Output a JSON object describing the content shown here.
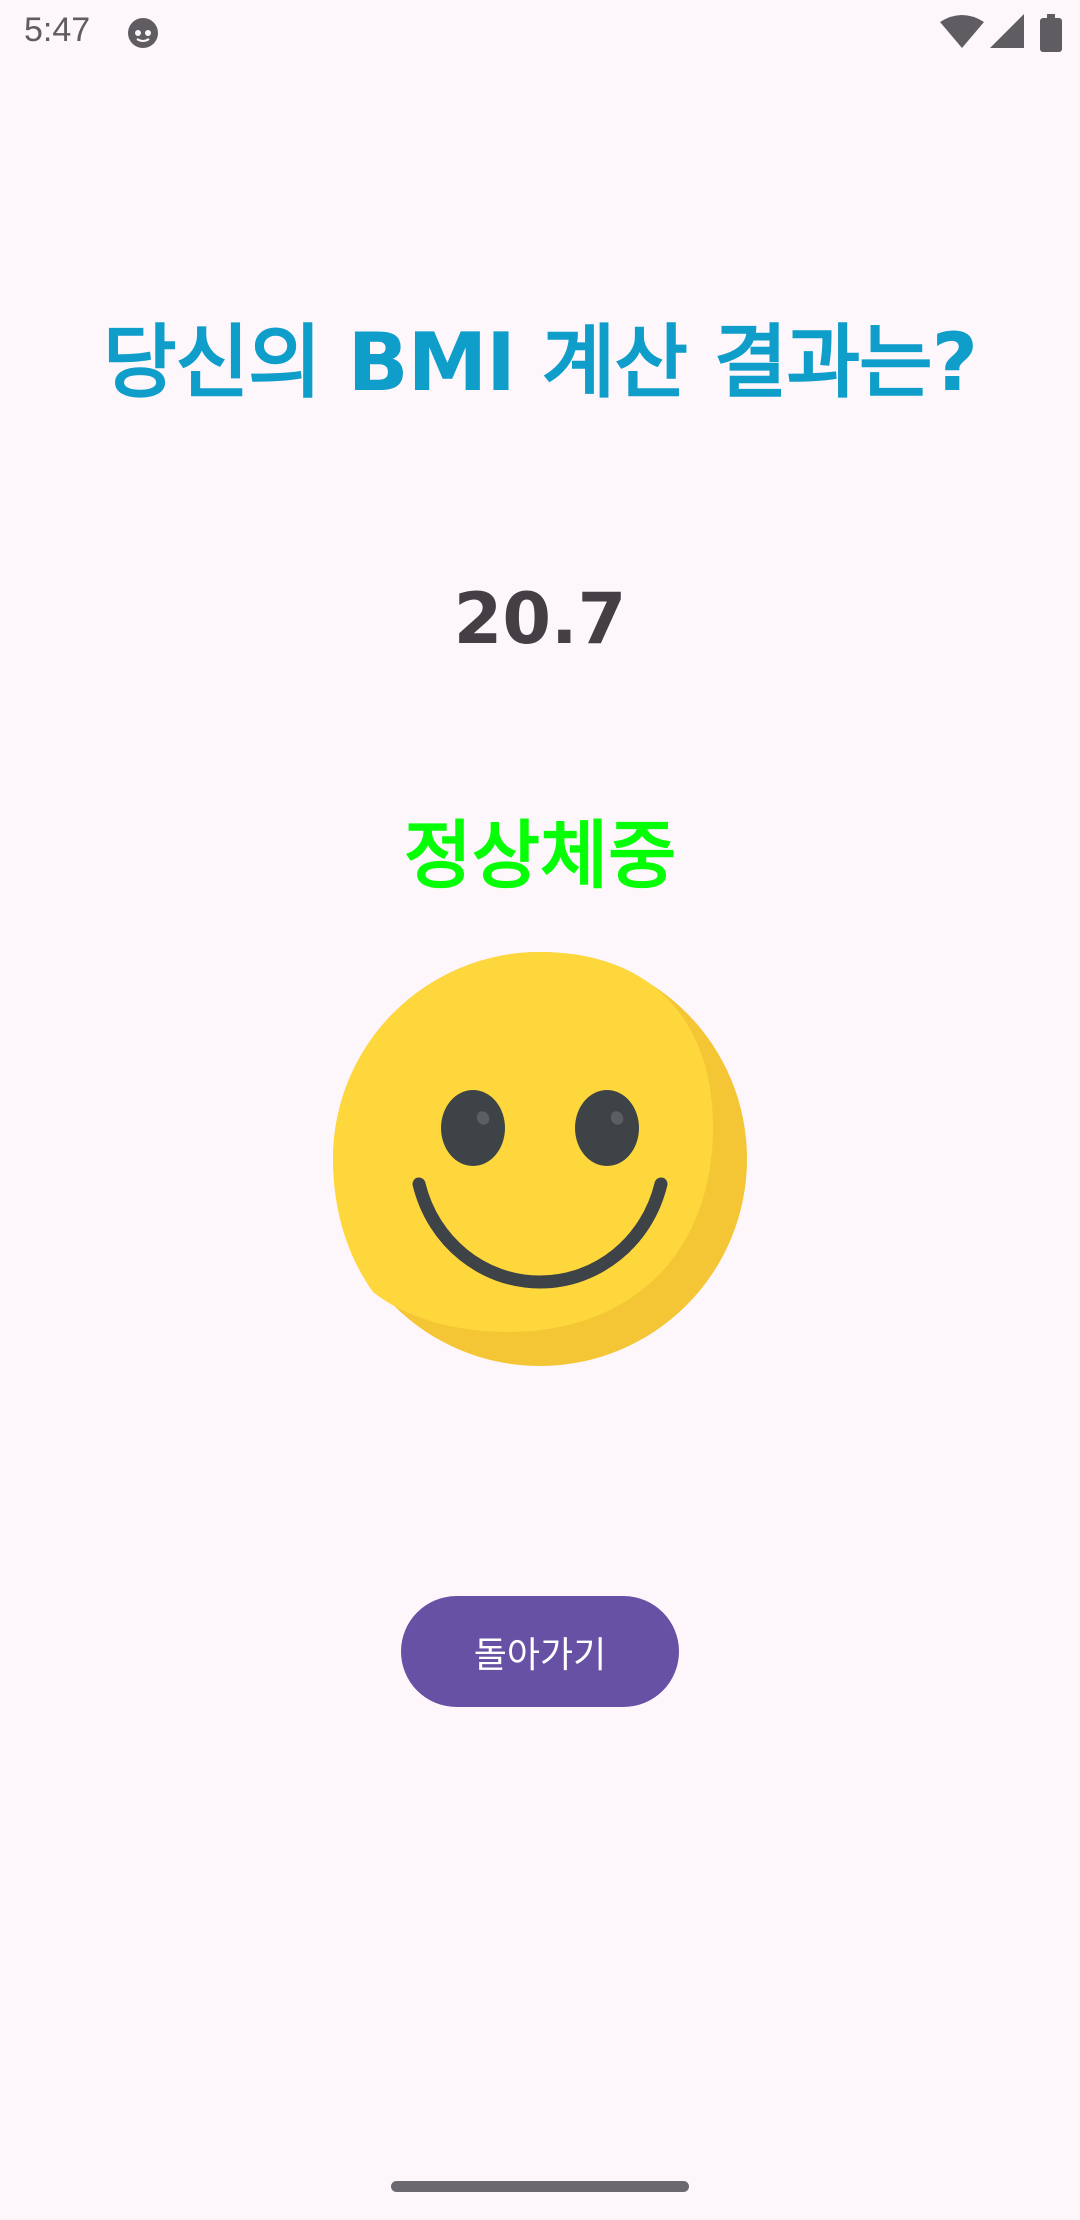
{
  "status_bar": {
    "time": "5:47",
    "app_icon": "android-cat-icon",
    "wifi_icon": "wifi-icon",
    "signal_icon": "cell-signal-icon",
    "battery_icon": "battery-icon"
  },
  "result": {
    "title": "당신의 BMI 계산 결과는?",
    "bmi_value": "20.7",
    "category": "정상체중",
    "emoji_icon": "smiling-face-icon"
  },
  "actions": {
    "back_label": "돌아가기"
  },
  "colors": {
    "background": "#fdf7fc",
    "title": "#0f9ec9",
    "value": "#443f45",
    "category": "#06ff06",
    "button": "#6751a5",
    "emoji_face": "#fdd73b",
    "emoji_shade": "#f4c534",
    "emoji_features": "#3e4347"
  }
}
